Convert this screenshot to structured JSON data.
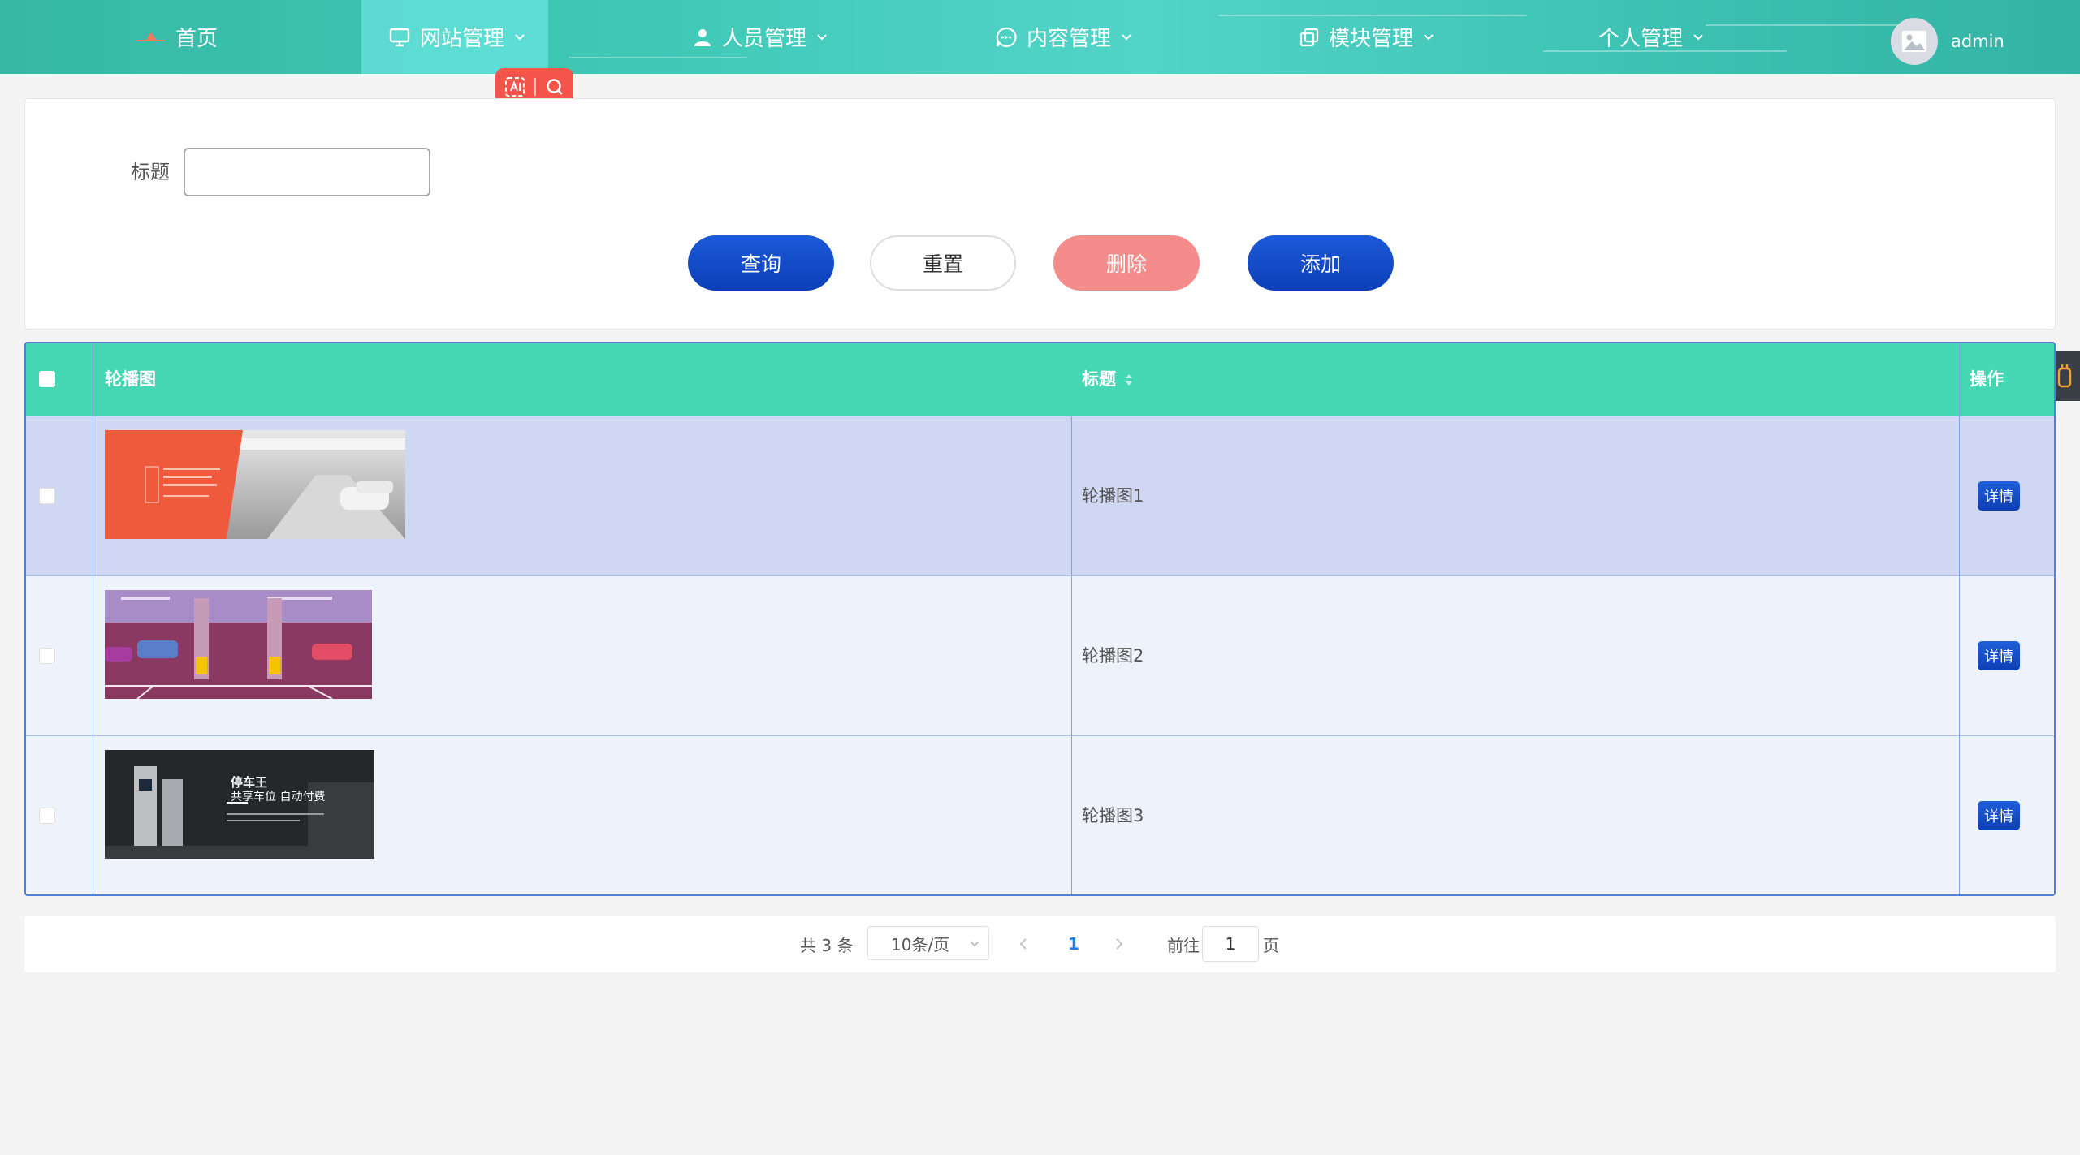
{
  "nav": {
    "items": [
      {
        "label": "首页",
        "icon": "home-icon"
      },
      {
        "label": "网站管理",
        "icon": "monitor-icon"
      },
      {
        "label": "人员管理",
        "icon": "user-icon"
      },
      {
        "label": "内容管理",
        "icon": "message-icon"
      },
      {
        "label": "模块管理",
        "icon": "copy-icon"
      },
      {
        "label": "个人管理",
        "icon": ""
      }
    ],
    "active_index": 1,
    "username": "admin"
  },
  "colors": {
    "nav_bg": "#3fc8b6",
    "header_bg": "#45d6b4",
    "primary": "#1c5ad8",
    "danger_light": "#f48c8c",
    "selected_row": "#cfd7f2",
    "widget_red": "#f4544a"
  },
  "search": {
    "title_label": "标题",
    "title_value": "",
    "title_placeholder": ""
  },
  "buttons": {
    "query": "查询",
    "reset": "重置",
    "delete": "删除",
    "add": "添加"
  },
  "table": {
    "columns": [
      "轮播图",
      "标题",
      "操作"
    ],
    "rows": [
      {
        "title": "轮播图1",
        "selected": true,
        "thumb_text": []
      },
      {
        "title": "轮播图2",
        "selected": false,
        "thumb_text": []
      },
      {
        "title": "轮播图3",
        "selected": false,
        "thumb_text": [
          "停车王",
          "共享车位 自动付费"
        ]
      }
    ],
    "detail_label": "详情"
  },
  "pagination": {
    "total_text": "共 3 条",
    "page_size": "10条/页",
    "current_page": "1",
    "goto_label": "前往",
    "goto_value": "1",
    "page_suffix": "页"
  }
}
